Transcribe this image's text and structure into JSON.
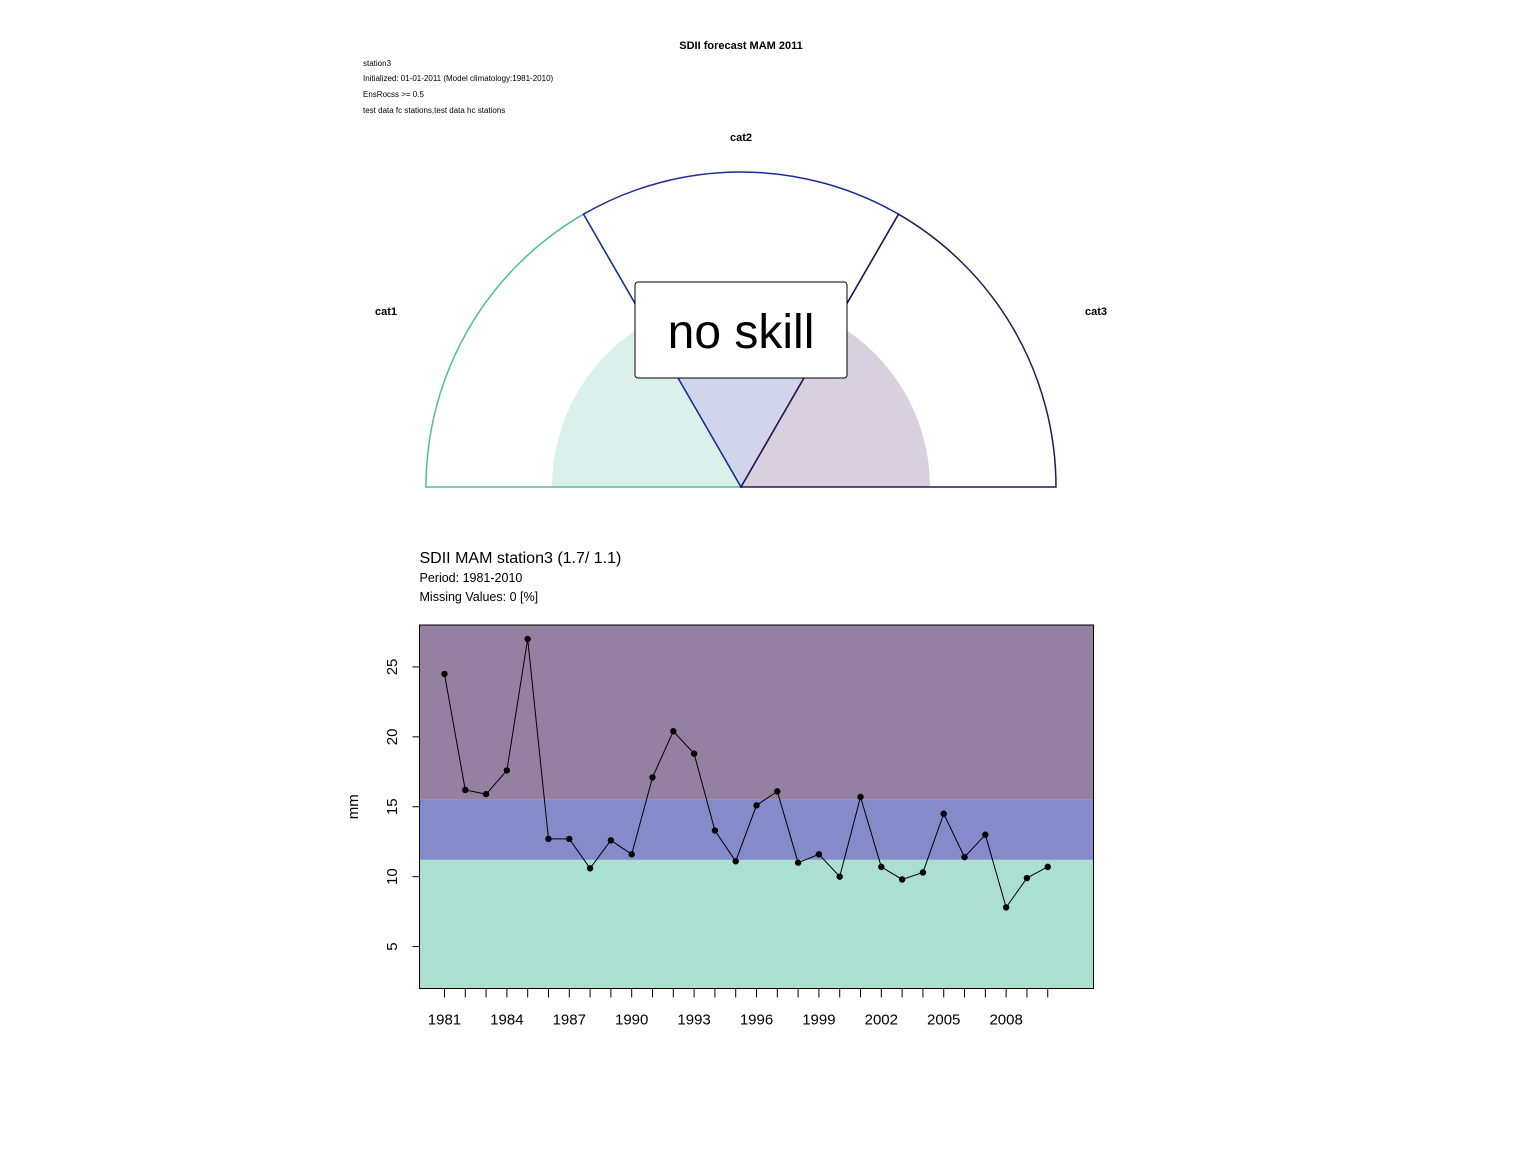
{
  "header": {
    "title": "SDII forecast MAM 2011",
    "meta_lines": [
      "station3",
      "Initialized: 01-01-2011 (Model climatology:1981-2010)",
      "EnsRocss >= 0.5",
      "test data fc stations,test data hc stations"
    ]
  },
  "gauge": {
    "categories": [
      "cat1",
      "cat2",
      "cat3"
    ],
    "category_colors": [
      "#4fbe98",
      "#1a2a96",
      "#2a1650"
    ],
    "category_fill_colors": [
      "#dcf0eb",
      "#d0d5eb",
      "#d9d0df"
    ],
    "probabilities_fraction_of_radius": [
      0.6,
      0.6,
      0.6
    ],
    "message": "no skill"
  },
  "chart_data": {
    "type": "line",
    "title": "SDII MAM station3 (1.7/ 1.1)",
    "subtitle_lines": [
      "Period: 1981-2010",
      "Missing Values: 0 [%]"
    ],
    "xlabel": "",
    "ylabel": "mm",
    "x": [
      1981,
      1982,
      1983,
      1984,
      1985,
      1986,
      1987,
      1988,
      1989,
      1990,
      1991,
      1992,
      1993,
      1994,
      1995,
      1996,
      1997,
      1998,
      1999,
      2000,
      2001,
      2002,
      2003,
      2004,
      2005,
      2006,
      2007,
      2008,
      2009,
      2010
    ],
    "values": [
      24.5,
      16.2,
      15.9,
      17.6,
      27.0,
      12.7,
      12.7,
      10.6,
      12.6,
      11.6,
      17.1,
      20.4,
      18.8,
      13.3,
      11.1,
      15.1,
      16.1,
      11.0,
      11.6,
      10.0,
      15.7,
      10.7,
      9.8,
      10.3,
      14.5,
      11.4,
      13.0,
      7.8,
      9.9,
      10.7
    ],
    "xlim": [
      1979.8,
      2012.2
    ],
    "ylim": [
      2.0,
      28.0
    ],
    "y_ticks": [
      5,
      10,
      15,
      20,
      25
    ],
    "x_ticks_labeled": [
      1981,
      1984,
      1987,
      1990,
      1993,
      1996,
      1999,
      2002,
      2005,
      2008
    ],
    "tercile_bounds": [
      11.2,
      15.5
    ],
    "band_colors": {
      "low": "#aadfd2",
      "mid": "#858bca",
      "high": "#9680a2"
    },
    "grid": false,
    "legend": "none"
  }
}
